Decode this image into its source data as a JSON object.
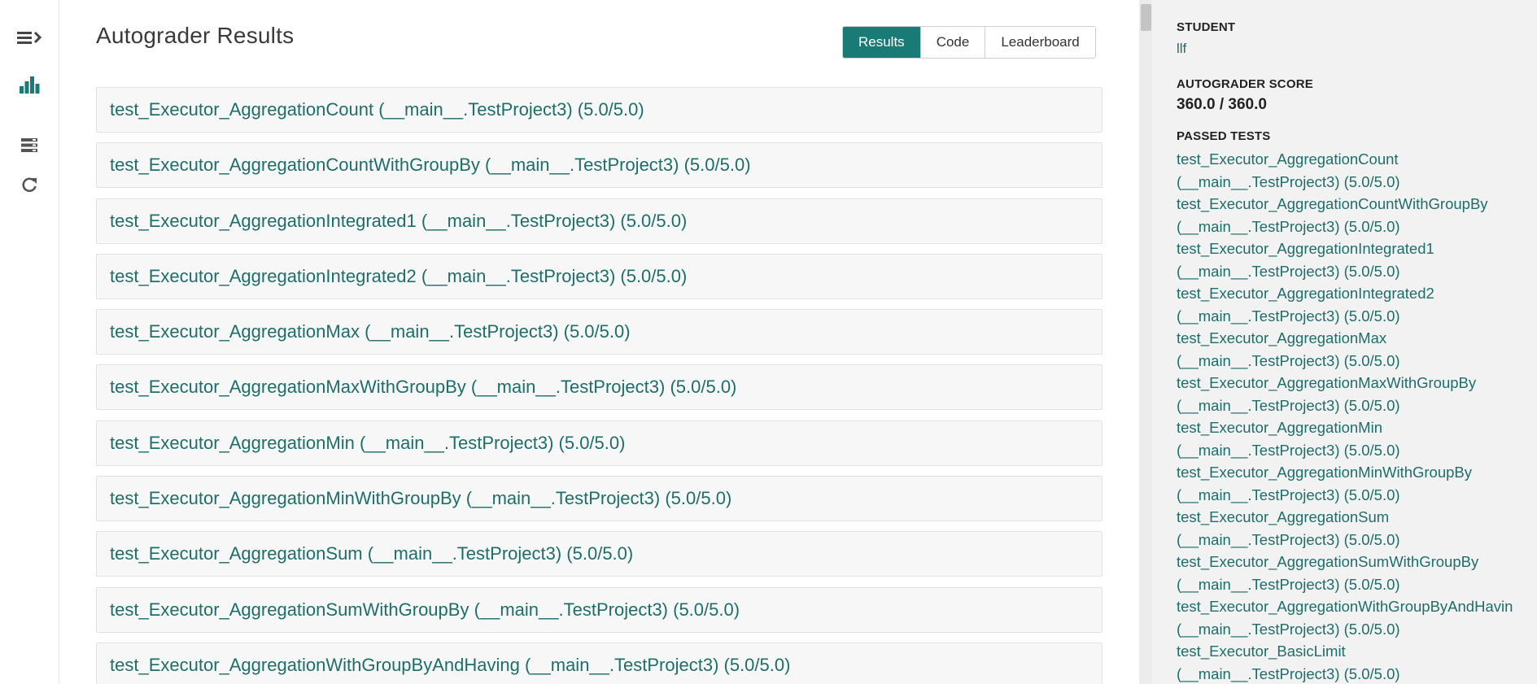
{
  "page": {
    "title": "Autograder Results"
  },
  "tabs": [
    {
      "label": "Results",
      "active": true
    },
    {
      "label": "Code",
      "active": false
    },
    {
      "label": "Leaderboard",
      "active": false
    }
  ],
  "sidebar_nav": {
    "icons": [
      "menu-expand-icon",
      "bar-chart-icon",
      "submissions-list-icon",
      "rerun-icon"
    ]
  },
  "tests": [
    "test_Executor_AggregationCount (__main__.TestProject3) (5.0/5.0)",
    "test_Executor_AggregationCountWithGroupBy (__main__.TestProject3) (5.0/5.0)",
    "test_Executor_AggregationIntegrated1 (__main__.TestProject3) (5.0/5.0)",
    "test_Executor_AggregationIntegrated2 (__main__.TestProject3) (5.0/5.0)",
    "test_Executor_AggregationMax (__main__.TestProject3) (5.0/5.0)",
    "test_Executor_AggregationMaxWithGroupBy (__main__.TestProject3) (5.0/5.0)",
    "test_Executor_AggregationMin (__main__.TestProject3) (5.0/5.0)",
    "test_Executor_AggregationMinWithGroupBy (__main__.TestProject3) (5.0/5.0)",
    "test_Executor_AggregationSum (__main__.TestProject3) (5.0/5.0)",
    "test_Executor_AggregationSumWithGroupBy (__main__.TestProject3) (5.0/5.0)",
    "test_Executor_AggregationWithGroupByAndHaving (__main__.TestProject3) (5.0/5.0)"
  ],
  "summary": {
    "student_label": "STUDENT",
    "student_name": "llf",
    "score_label": "AUTOGRADER SCORE",
    "score_value": "360.0 / 360.0",
    "passed_label": "PASSED TESTS",
    "passed_tests": [
      {
        "name": "test_Executor_AggregationCount",
        "detail": "(__main__.TestProject3) (5.0/5.0)"
      },
      {
        "name": "test_Executor_AggregationCountWithGroupBy",
        "detail": "(__main__.TestProject3) (5.0/5.0)"
      },
      {
        "name": "test_Executor_AggregationIntegrated1",
        "detail": "(__main__.TestProject3) (5.0/5.0)"
      },
      {
        "name": "test_Executor_AggregationIntegrated2",
        "detail": "(__main__.TestProject3) (5.0/5.0)"
      },
      {
        "name": "test_Executor_AggregationMax",
        "detail": "(__main__.TestProject3) (5.0/5.0)"
      },
      {
        "name": "test_Executor_AggregationMaxWithGroupBy",
        "detail": "(__main__.TestProject3) (5.0/5.0)"
      },
      {
        "name": "test_Executor_AggregationMin",
        "detail": "(__main__.TestProject3) (5.0/5.0)"
      },
      {
        "name": "test_Executor_AggregationMinWithGroupBy",
        "detail": "(__main__.TestProject3) (5.0/5.0)"
      },
      {
        "name": "test_Executor_AggregationSum",
        "detail": "(__main__.TestProject3) (5.0/5.0)"
      },
      {
        "name": "test_Executor_AggregationSumWithGroupBy",
        "detail": "(__main__.TestProject3) (5.0/5.0)"
      },
      {
        "name": "test_Executor_AggregationWithGroupByAndHavin",
        "detail": "(__main__.TestProject3) (5.0/5.0)"
      },
      {
        "name": "test_Executor_BasicLimit",
        "detail": "(__main__.TestProject3) (5.0/5.0)"
      }
    ]
  },
  "colors": {
    "accent": "#1a7b76",
    "link": "#1e6e69",
    "row_bg": "#f7f7f8",
    "sidebar_bg": "#f2f2f2"
  }
}
